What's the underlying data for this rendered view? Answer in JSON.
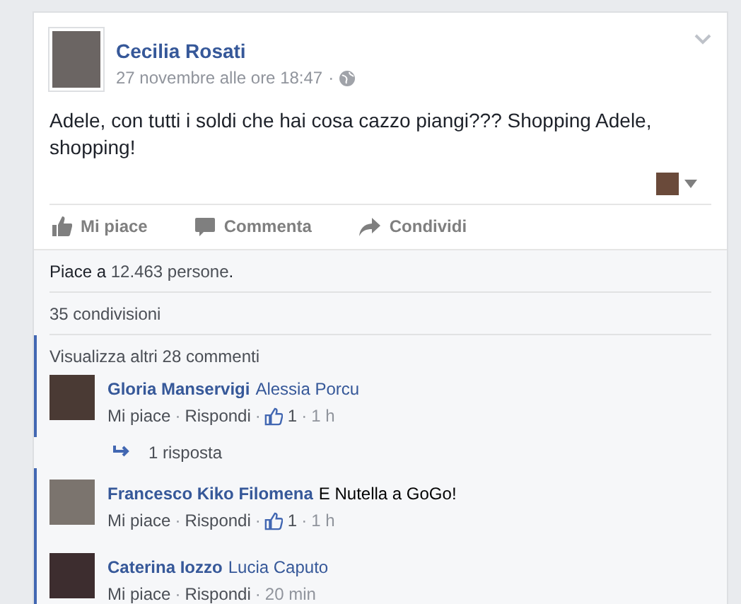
{
  "post": {
    "author": "Cecilia Rosati",
    "timestamp": "27 novembre alle ore 18:47",
    "separator": "·",
    "text": "Adele, con tutti i soldi che hai cosa cazzo piangi??? Shopping Adele, shopping!"
  },
  "actions": [
    {
      "label": "Mi piace",
      "kind": "like"
    },
    {
      "label": "Commenta",
      "kind": "comment"
    },
    {
      "label": "Condividi",
      "kind": "share"
    }
  ],
  "likes_summary": {
    "prefix": "Piace a",
    "link": "12.463 persone",
    "suffix": "."
  },
  "shares": "35 condivisioni",
  "view_more": "Visualizza altri 28 commenti",
  "comments": [
    {
      "author": "Gloria Manservigi",
      "text": "Alessia Porcu",
      "kind": "tag",
      "separator": "·",
      "like_action": "Mi piace",
      "reply_action": "Rispondi",
      "likes": "1",
      "time": "1 h",
      "unread": true,
      "replies": "1 risposta"
    },
    {
      "author": "Francesco Kiko Filomena",
      "text": "E Nutella a GoGo!",
      "kind": "plain",
      "separator": "·",
      "like_action": "Mi piace",
      "reply_action": "Rispondi",
      "likes": "1",
      "time": "1 h",
      "unread": true
    },
    {
      "author": "Caterina Iozzo",
      "text": "Lucia Caputo",
      "kind": "tag",
      "separator": "·",
      "like_action": "Mi piace",
      "reply_action": "Rispondi",
      "time": "20 min",
      "unread": true
    }
  ]
}
